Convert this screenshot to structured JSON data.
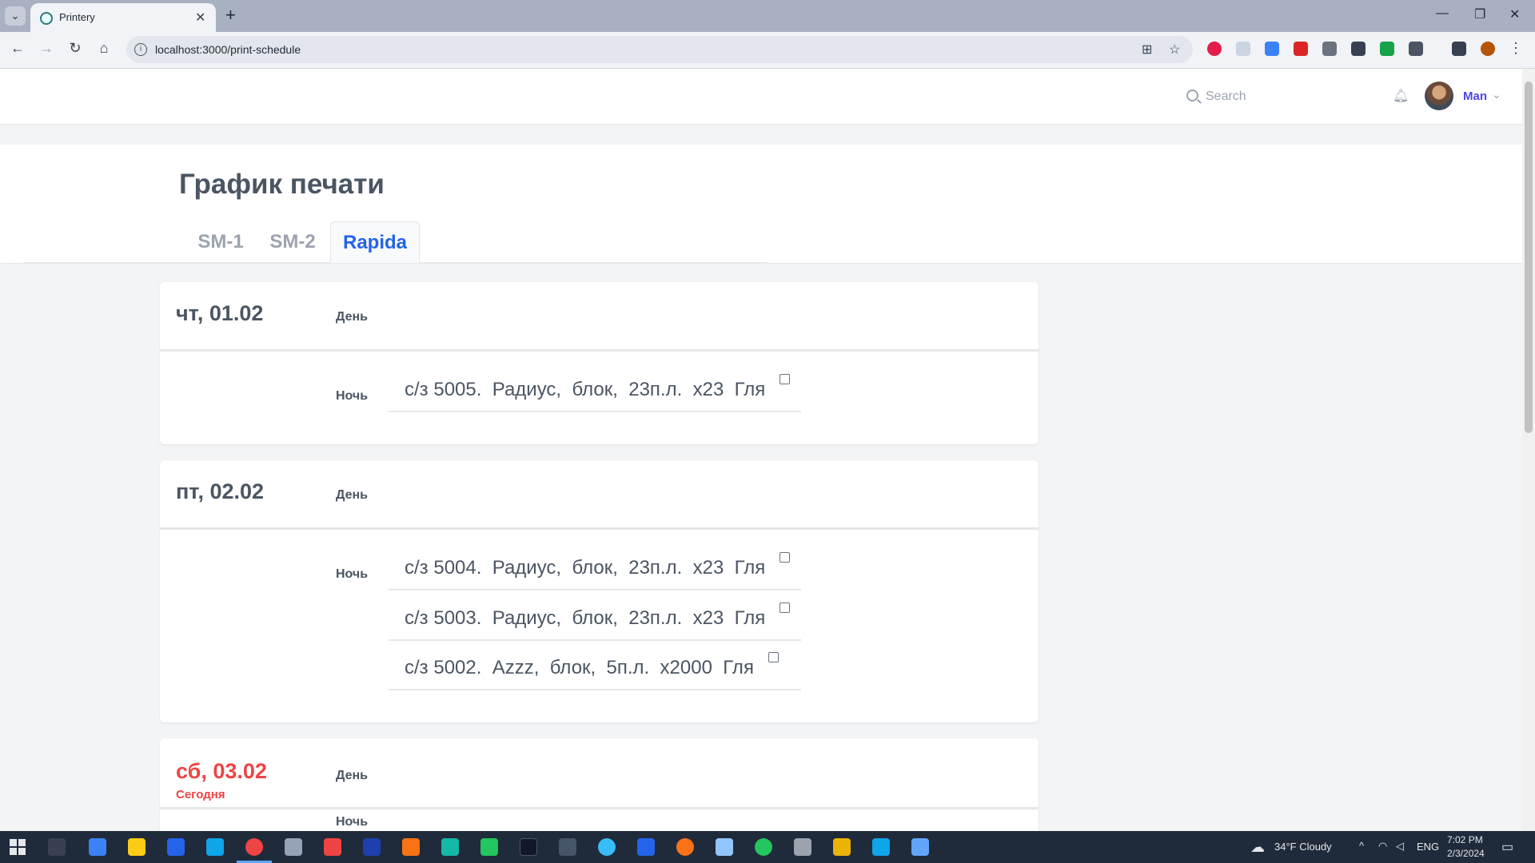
{
  "browser": {
    "tab_title": "Printery",
    "url": "localhost:3000/print-schedule"
  },
  "topnav": {
    "search_placeholder": "Search",
    "user_name": "Man"
  },
  "page": {
    "title": "График печати",
    "tabs": [
      {
        "label": "SM-1",
        "active": false
      },
      {
        "label": "SM-2",
        "active": false
      },
      {
        "label": "Rapida",
        "active": true
      }
    ]
  },
  "schedule": [
    {
      "date": "чт, 01.02",
      "today": false,
      "day_label": "День",
      "night_label": "Ночь",
      "night_jobs": [
        {
          "text": "с/з 5005.  Радиус,  блок,  23п.л.  х23  Гля",
          "checked": false
        }
      ]
    },
    {
      "date": "пт, 02.02",
      "today": false,
      "day_label": "День",
      "night_label": "Ночь",
      "night_jobs": [
        {
          "text": "с/з 5004.  Радиус,  блок,  23п.л.  х23  Гля",
          "checked": false
        },
        {
          "text": "с/з 5003.  Радиус,  блок,  23п.л.  х23  Гля",
          "checked": false
        },
        {
          "text": "с/з 5002.  Azzz,  блок,  5п.л.  х2000  Гля",
          "checked": false
        }
      ]
    },
    {
      "date": "сб, 03.02",
      "today": true,
      "today_label": "Сегодня",
      "day_label": "День",
      "night_label": "Ночь"
    }
  ],
  "taskbar": {
    "weather": "34°F  Cloudy",
    "lang": "ENG",
    "time": "7:02 PM",
    "date": "2/3/2024"
  }
}
